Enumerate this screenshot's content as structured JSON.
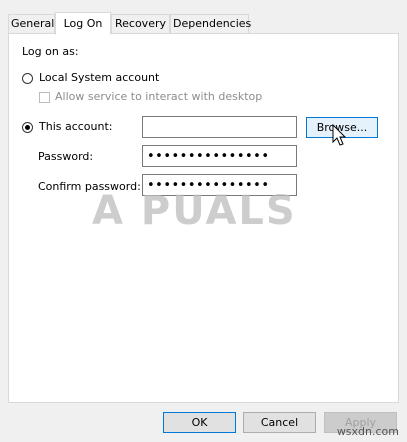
{
  "tabs": [
    {
      "label": "General"
    },
    {
      "label": "Log On"
    },
    {
      "label": "Recovery"
    },
    {
      "label": "Dependencies"
    }
  ],
  "logon": {
    "heading": "Log on as:",
    "local_system_label": "Local System account",
    "allow_interact_label": "Allow service to interact with desktop",
    "this_account_label": "This account:",
    "this_account_value": "",
    "browse_label": "Browse...",
    "password_label": "Password:",
    "password_value": "•••••••••••••••",
    "confirm_password_label": "Confirm password:",
    "confirm_password_value": "•••••••••••••••"
  },
  "buttons": {
    "ok": "OK",
    "cancel": "Cancel",
    "apply": "Apply"
  },
  "watermark": "A  PUALS",
  "credit": "wsxdn.com",
  "colors": {
    "accent": "#0078d7",
    "panel": "#ffffff",
    "window": "#f0f0f0"
  }
}
